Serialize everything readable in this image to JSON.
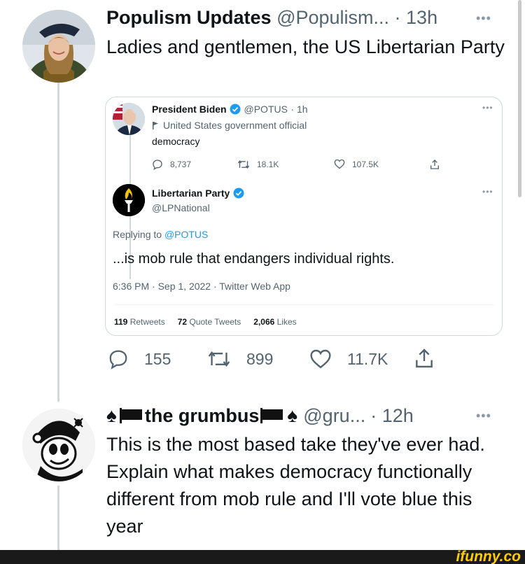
{
  "tweet1": {
    "name": "Populism Updates",
    "handle": "@Populism...",
    "time": "· 13h",
    "text": "Ladies and gentlemen, the US Libertarian Party",
    "quote": {
      "potus": {
        "name": "President Biden",
        "handle": "@POTUS",
        "time": "· 1h",
        "label": "United States government official",
        "text": "democracy",
        "replies": "8,737",
        "retweets": "18.1K",
        "likes": "107.5K"
      },
      "lp": {
        "name": "Libertarian Party",
        "handle": "@LPNational",
        "replying_prefix": "Replying to",
        "replying_to": "@POTUS",
        "text": "...is mob rule that endangers individual rights.",
        "timestamp": "6:36 PM · Sep 1, 2022 · Twitter Web App",
        "retweets_count": "119",
        "retweets_label": "Retweets",
        "quotes_count": "72",
        "quotes_label": "Quote Tweets",
        "likes_count": "2,066",
        "likes_label": "Likes"
      }
    },
    "actions": {
      "replies": "155",
      "retweets": "899",
      "likes": "11.7K"
    }
  },
  "tweet2": {
    "name": "the grumbus",
    "handle": "@gru...",
    "time": "· 12h",
    "text": "This is the most based take they've ever had. Explain what makes democracy functionally different from mob rule and I'll vote blue this year"
  },
  "watermark": "ifunny.co",
  "colors": {
    "verified": "#1d9bf0",
    "muted": "#536471",
    "border": "#cfd9de",
    "watermark": "#ffcc00"
  }
}
